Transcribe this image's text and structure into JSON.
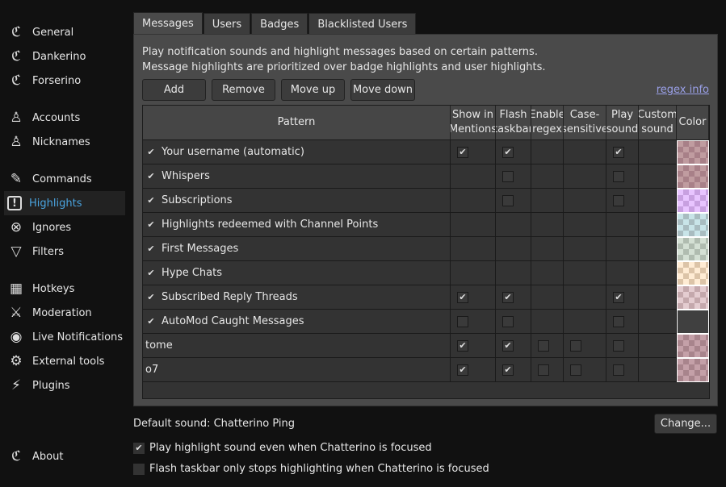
{
  "sidebar": {
    "items": [
      {
        "label": "General",
        "icon": "chatterino-logo-icon"
      },
      {
        "label": "Dankerino",
        "icon": "chatterino-logo-icon"
      },
      {
        "label": "Forserino",
        "icon": "chatterino-logo-icon"
      },
      {
        "label": "Accounts",
        "icon": "user-icon"
      },
      {
        "label": "Nicknames",
        "icon": "user-icon"
      },
      {
        "label": "Commands",
        "icon": "commands-icon"
      },
      {
        "label": "Highlights",
        "icon": "exclamation-icon",
        "active": true
      },
      {
        "label": "Ignores",
        "icon": "x-circle-icon"
      },
      {
        "label": "Filters",
        "icon": "funnel-icon"
      },
      {
        "label": "Hotkeys",
        "icon": "keyboard-icon"
      },
      {
        "label": "Moderation",
        "icon": "sword-icon"
      },
      {
        "label": "Live Notifications",
        "icon": "broadcast-icon"
      },
      {
        "label": "External tools",
        "icon": "gear-icon"
      },
      {
        "label": "Plugins",
        "icon": "plug-icon"
      },
      {
        "label": "About",
        "icon": "chatterino-logo-icon"
      }
    ]
  },
  "tabs": [
    "Messages",
    "Users",
    "Badges",
    "Blacklisted Users"
  ],
  "description": [
    "Play notification sounds and highlight messages based on certain patterns.",
    "Message highlights are prioritized over badge highlights and user highlights."
  ],
  "buttons": {
    "add": "Add",
    "remove": "Remove",
    "move_up": "Move up",
    "move_down": "Move down"
  },
  "regex_info": "regex info",
  "table": {
    "headers": [
      "Pattern",
      "Show in\nMentions",
      "Flash\ntaskbar",
      "Enable\nregex",
      "Case-\nsensitive",
      "Play\nsound",
      "Custom\nsound",
      "Color"
    ],
    "rows": [
      {
        "pattern": "Your username (automatic)",
        "enabled": true,
        "mentions": true,
        "flash": true,
        "regex": null,
        "case": null,
        "sound": true,
        "color": [
          "#c09ca0",
          "#a88088"
        ]
      },
      {
        "pattern": "Whispers",
        "enabled": true,
        "mentions": null,
        "flash": false,
        "regex": null,
        "case": null,
        "sound": false,
        "color": [
          "#c09ca0",
          "#a88088"
        ]
      },
      {
        "pattern": "Subscriptions",
        "enabled": true,
        "mentions": null,
        "flash": false,
        "regex": null,
        "case": null,
        "sound": false,
        "color": [
          "#e8c4ff",
          "#c8a0e0"
        ]
      },
      {
        "pattern": "Highlights redeemed with Channel Points",
        "enabled": true,
        "mentions": null,
        "flash": null,
        "regex": null,
        "case": null,
        "sound": null,
        "color": [
          "#c8e4e8",
          "#a8bcc0"
        ]
      },
      {
        "pattern": "First Messages",
        "enabled": true,
        "mentions": null,
        "flash": null,
        "regex": null,
        "case": null,
        "sound": null,
        "color": [
          "#d4e0d4",
          "#b0bcb0"
        ]
      },
      {
        "pattern": "Hype Chats",
        "enabled": true,
        "mentions": null,
        "flash": null,
        "regex": null,
        "case": null,
        "sound": null,
        "color": [
          "#ffecd4",
          "#dcc4a8"
        ]
      },
      {
        "pattern": "Subscribed Reply Threads",
        "enabled": true,
        "mentions": true,
        "flash": true,
        "regex": null,
        "case": null,
        "sound": true,
        "color": [
          "#e4ccd0",
          "#c4a8ac"
        ]
      },
      {
        "pattern": "AutoMod Caught Messages",
        "enabled": true,
        "mentions": false,
        "flash": false,
        "regex": null,
        "case": null,
        "sound": false,
        "color": [
          "#404040",
          "#404040"
        ]
      },
      {
        "pattern": "tome",
        "enabled": null,
        "mentions": true,
        "flash": true,
        "regex": false,
        "case": false,
        "sound": false,
        "color": [
          "#c4a0a8",
          "#a8848c"
        ]
      },
      {
        "pattern": "o7",
        "enabled": null,
        "mentions": true,
        "flash": true,
        "regex": false,
        "case": false,
        "sound": false,
        "color": [
          "#c4a0a8",
          "#a8848c"
        ]
      }
    ]
  },
  "default_sound": "Default sound: Chatterino Ping",
  "change_button": "Change...",
  "options": [
    {
      "label": "Play highlight sound even when Chatterino is focused",
      "checked": true
    },
    {
      "label": "Flash taskbar only stops highlighting when Chatterino is focused",
      "checked": false
    }
  ]
}
